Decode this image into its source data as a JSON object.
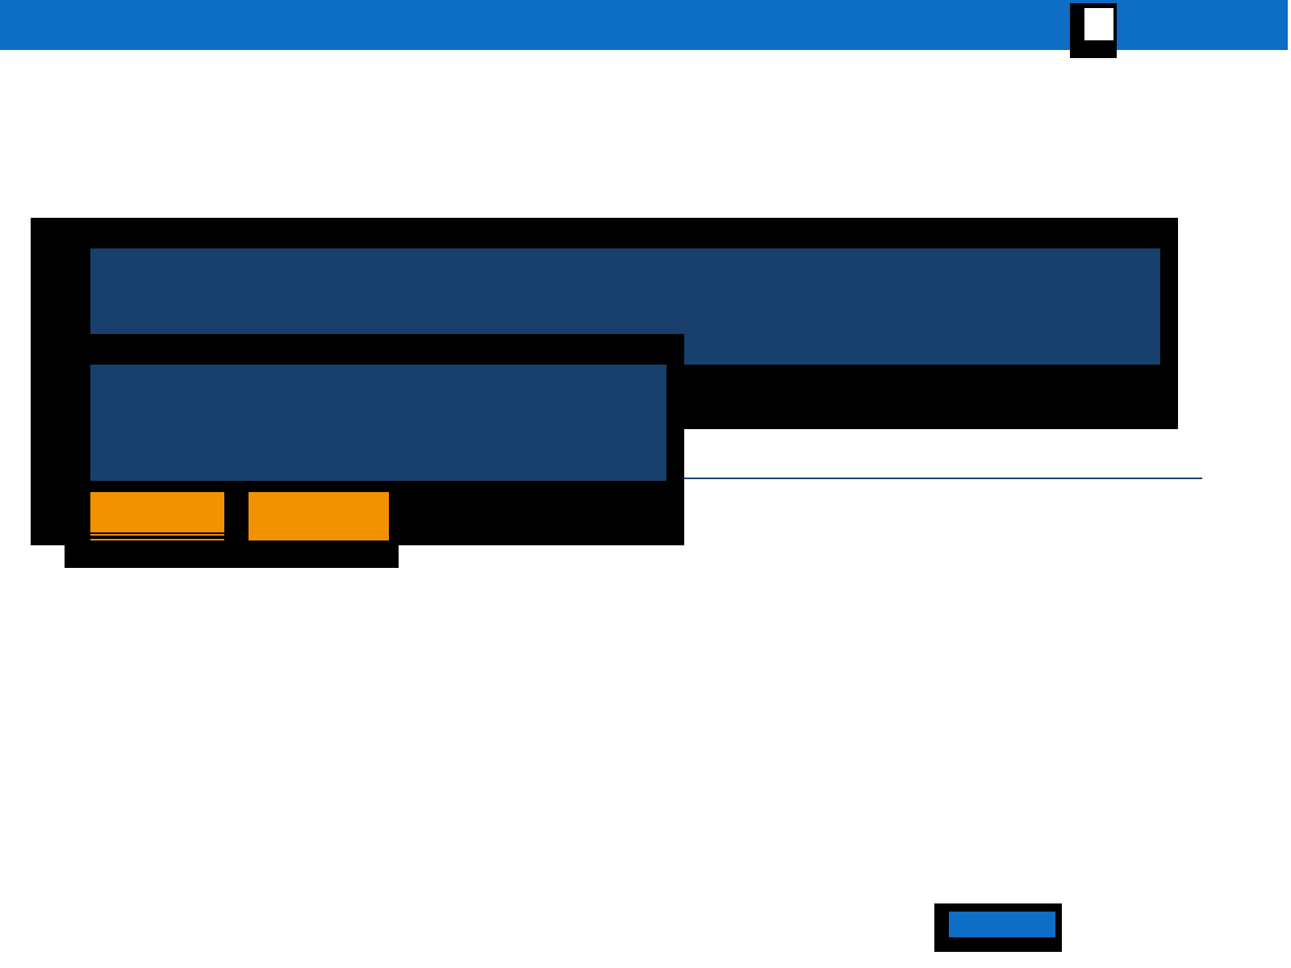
{
  "dialog": {
    "actions": [
      {
        "kind": "underlined"
      },
      {
        "kind": "plain"
      }
    ]
  },
  "footer": {
    "actions": [
      {
        "kind": "framed"
      }
    ]
  }
}
